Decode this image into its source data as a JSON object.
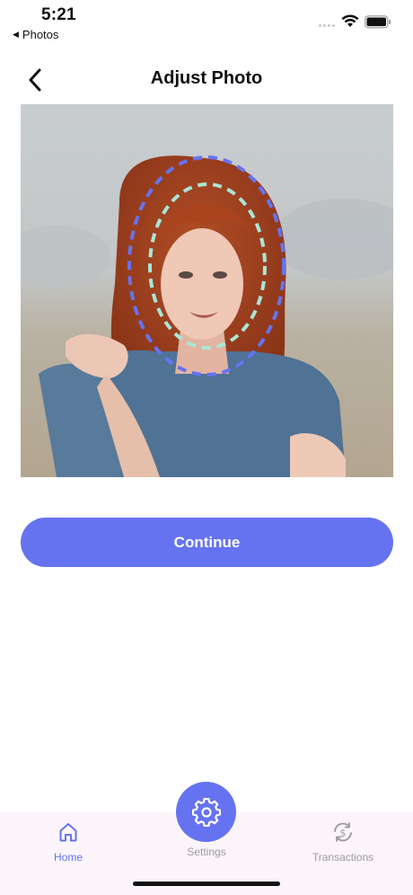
{
  "status_bar": {
    "time": "5:21",
    "back_app": "Photos",
    "back_arrow": "◀"
  },
  "header": {
    "title": "Adjust Photo",
    "back_icon": "chevron-left-icon"
  },
  "photo": {
    "outer_guide_color": "#6673f1",
    "inner_guide_color": "#a9e6d8"
  },
  "actions": {
    "continue_label": "Continue",
    "accent_color": "#6673f1"
  },
  "tab_bar": {
    "tabs": [
      {
        "label": "Home",
        "icon": "home-icon",
        "active": true
      },
      {
        "label": "Settings",
        "icon": "gear-icon",
        "active": false
      },
      {
        "label": "Transactions",
        "icon": "currency-exchange-icon",
        "active": false
      }
    ]
  }
}
